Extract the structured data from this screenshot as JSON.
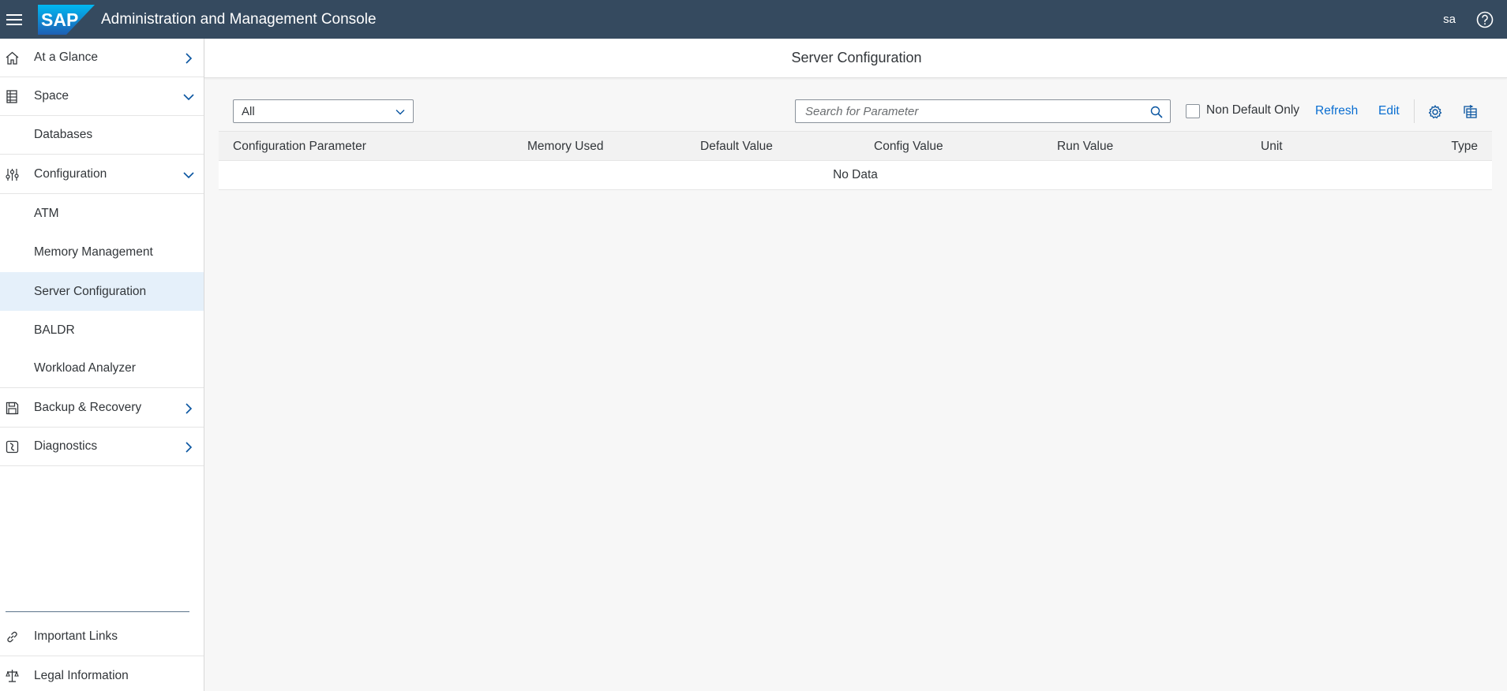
{
  "shell": {
    "app_title": "Administration and Management Console",
    "logo_text": "SAP",
    "user": "sa"
  },
  "sidebar": {
    "items": [
      {
        "label": "At a Glance",
        "icon": "home-icon",
        "chevron": "right"
      },
      {
        "label": "Space",
        "icon": "ruler-grid-icon",
        "chevron": "down"
      },
      {
        "label": "Databases"
      },
      {
        "label": "Configuration",
        "icon": "sliders-icon",
        "chevron": "down"
      },
      {
        "label": "ATM"
      },
      {
        "label": "Memory Management"
      },
      {
        "label": "Server Configuration",
        "selected": true
      },
      {
        "label": "BALDR"
      },
      {
        "label": "Workload Analyzer"
      },
      {
        "label": "Backup & Recovery",
        "icon": "save-icon",
        "chevron": "right"
      },
      {
        "label": "Diagnostics",
        "icon": "diagnostics-icon",
        "chevron": "right"
      }
    ],
    "footer": [
      {
        "label": "Important Links",
        "icon": "link-icon"
      },
      {
        "label": "Legal Information",
        "icon": "scales-icon"
      }
    ]
  },
  "main": {
    "title": "Server Configuration",
    "filter": {
      "selected": "All"
    },
    "search": {
      "placeholder": "Search for Parameter",
      "value": ""
    },
    "non_default_only": {
      "label": "Non Default Only",
      "checked": false
    },
    "refresh_label": "Refresh",
    "edit_label": "Edit",
    "table": {
      "columns": [
        "Configuration Parameter",
        "Memory Used",
        "Default Value",
        "Config Value",
        "Run Value",
        "Unit",
        "Type"
      ],
      "empty_text": "No Data"
    }
  },
  "colors": {
    "shellbar": "#354a5f",
    "accent": "#0a6ed1",
    "selected_bg": "#e5f0fa"
  }
}
